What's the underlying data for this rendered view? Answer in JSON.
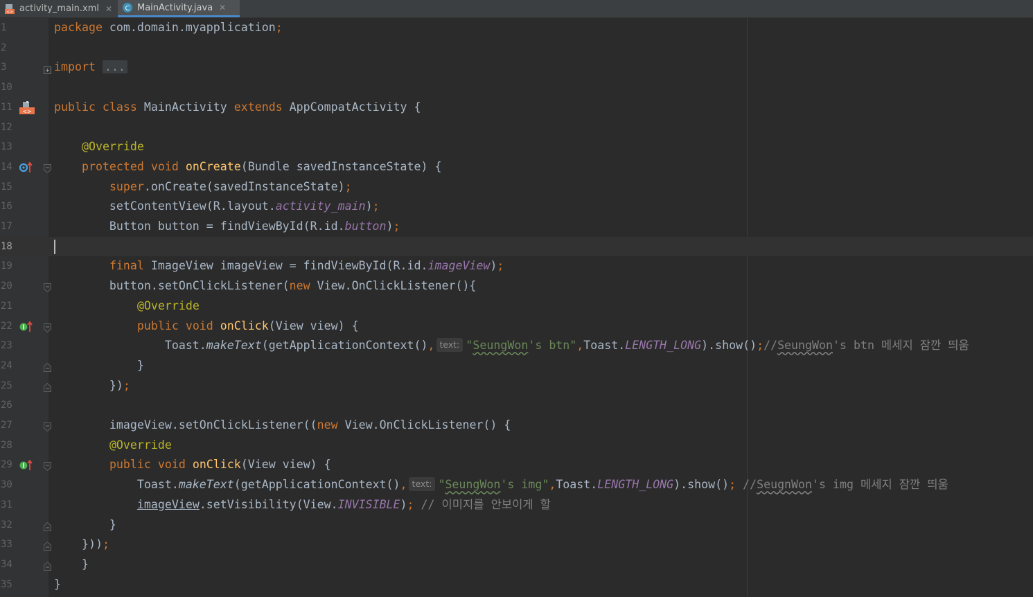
{
  "tabs": [
    {
      "label": "activity_main.xml",
      "active": false
    },
    {
      "label": "MainActivity.java",
      "active": true
    }
  ],
  "colors": {
    "background": "#2b2b2b",
    "keyword": "#cc7832",
    "annotation": "#bbb529",
    "method_declaration": "#ffc66d",
    "string": "#6a8759",
    "static_field": "#9876aa",
    "comment": "#808080",
    "default_text": "#a9b7c6"
  },
  "editor": {
    "current_line": "18",
    "lines": [
      {
        "n": "1",
        "tokens": [
          [
            "kw",
            "package"
          ],
          [
            "t",
            " com.domain.myapplication"
          ],
          [
            "kw",
            ";"
          ]
        ]
      },
      {
        "n": "2",
        "tokens": []
      },
      {
        "n": "3",
        "fold": "plus",
        "tokens": [
          [
            "kw",
            "import"
          ],
          [
            "t",
            " "
          ],
          [
            "fold",
            "..."
          ]
        ]
      },
      {
        "n": "10",
        "tokens": []
      },
      {
        "n": "11",
        "marker": "class-icon",
        "tokens": [
          [
            "kw",
            "public class"
          ],
          [
            "t",
            " MainActivity "
          ],
          [
            "kw",
            "extends"
          ],
          [
            "t",
            " AppCompatActivity {"
          ]
        ]
      },
      {
        "n": "12",
        "tokens": []
      },
      {
        "n": "13",
        "tokens": [
          [
            "t",
            "    "
          ],
          [
            "an",
            "@Override"
          ]
        ]
      },
      {
        "n": "14",
        "marker": "override-up",
        "fold": "open",
        "tokens": [
          [
            "t",
            "    "
          ],
          [
            "kw",
            "protected void"
          ],
          [
            "t",
            " "
          ],
          [
            "fn",
            "onCreate"
          ],
          [
            "t",
            "(Bundle savedInstanceState) {"
          ]
        ]
      },
      {
        "n": "15",
        "tokens": [
          [
            "t",
            "        "
          ],
          [
            "kw",
            "super"
          ],
          [
            "t",
            ".onCreate(savedInstanceState)"
          ],
          [
            "kw",
            ";"
          ]
        ]
      },
      {
        "n": "16",
        "tokens": [
          [
            "t",
            "        setContentView(R.layout."
          ],
          [
            "fd",
            "activity_main"
          ],
          [
            "t",
            ")"
          ],
          [
            "kw",
            ";"
          ]
        ]
      },
      {
        "n": "17",
        "tokens": [
          [
            "t",
            "        Button button = findViewById(R.id."
          ],
          [
            "fd",
            "button"
          ],
          [
            "t",
            ")"
          ],
          [
            "kw",
            ";"
          ]
        ]
      },
      {
        "n": "18",
        "tokens": []
      },
      {
        "n": "19",
        "tokens": [
          [
            "t",
            "        "
          ],
          [
            "kw",
            "final"
          ],
          [
            "t",
            " ImageView imageView = findViewById(R.id."
          ],
          [
            "fd",
            "imageView"
          ],
          [
            "t",
            ")"
          ],
          [
            "kw",
            ";"
          ]
        ]
      },
      {
        "n": "20",
        "fold": "open",
        "tokens": [
          [
            "t",
            "        button.setOnClickListener("
          ],
          [
            "kw",
            "new"
          ],
          [
            "t",
            " View.OnClickListener(){"
          ]
        ]
      },
      {
        "n": "21",
        "tokens": [
          [
            "t",
            "            "
          ],
          [
            "an",
            "@Override"
          ]
        ]
      },
      {
        "n": "22",
        "marker": "implement-up",
        "fold": "open",
        "tokens": [
          [
            "t",
            "            "
          ],
          [
            "kw",
            "public void"
          ],
          [
            "t",
            " "
          ],
          [
            "fn",
            "onClick"
          ],
          [
            "t",
            "(View view) {"
          ]
        ]
      },
      {
        "n": "23",
        "tokens": [
          [
            "t",
            "                Toast."
          ],
          [
            "it",
            "makeText"
          ],
          [
            "t",
            "(getApplicationContext()"
          ],
          [
            "kw",
            ","
          ],
          [
            "hint",
            "text:"
          ],
          [
            "st",
            "\""
          ],
          [
            "stw",
            "SeungWon"
          ],
          [
            "st",
            "'s btn\""
          ],
          [
            "kw",
            ","
          ],
          [
            "t",
            "Toast."
          ],
          [
            "fd",
            "LENGTH_LONG"
          ],
          [
            "t",
            ").show()"
          ],
          [
            "kw",
            ";"
          ],
          [
            "cm",
            "//"
          ],
          [
            "cmw",
            "SeungWon"
          ],
          [
            "cm",
            "'s btn 메세지 잠깐 띄움"
          ]
        ]
      },
      {
        "n": "24",
        "fold": "close",
        "tokens": [
          [
            "t",
            "            }"
          ]
        ]
      },
      {
        "n": "25",
        "fold": "close",
        "tokens": [
          [
            "t",
            "        })"
          ],
          [
            "kw",
            ";"
          ]
        ]
      },
      {
        "n": "26",
        "tokens": []
      },
      {
        "n": "27",
        "fold": "open",
        "tokens": [
          [
            "t",
            "        imageView.setOnClickListener(("
          ],
          [
            "kw",
            "new"
          ],
          [
            "t",
            " View.OnClickListener() {"
          ]
        ]
      },
      {
        "n": "28",
        "tokens": [
          [
            "t",
            "        "
          ],
          [
            "an",
            "@Override"
          ]
        ]
      },
      {
        "n": "29",
        "marker": "implement-up",
        "fold": "open",
        "tokens": [
          [
            "t",
            "        "
          ],
          [
            "kw",
            "public void"
          ],
          [
            "t",
            " "
          ],
          [
            "fn",
            "onClick"
          ],
          [
            "t",
            "(View view) {"
          ]
        ]
      },
      {
        "n": "30",
        "tokens": [
          [
            "t",
            "            Toast."
          ],
          [
            "it",
            "makeText"
          ],
          [
            "t",
            "(getApplicationContext()"
          ],
          [
            "kw",
            ","
          ],
          [
            "hint",
            "text:"
          ],
          [
            "st",
            "\""
          ],
          [
            "stw",
            "SeungWon"
          ],
          [
            "st",
            "'s img\""
          ],
          [
            "kw",
            ","
          ],
          [
            "t",
            "Toast."
          ],
          [
            "fd",
            "LENGTH_LONG"
          ],
          [
            "t",
            ").show()"
          ],
          [
            "kw",
            ";"
          ],
          [
            "t",
            " "
          ],
          [
            "cm",
            "//"
          ],
          [
            "cmw",
            "SeugnWon"
          ],
          [
            "cm",
            "'s img 메세지 잠깐 띄움"
          ]
        ]
      },
      {
        "n": "31",
        "tokens": [
          [
            "t",
            "            "
          ],
          [
            "ul",
            "imageView"
          ],
          [
            "t",
            ".setVisibility(View."
          ],
          [
            "fd",
            "INVISIBLE"
          ],
          [
            "t",
            ")"
          ],
          [
            "kw",
            ";"
          ],
          [
            "t",
            " "
          ],
          [
            "cm",
            "// 이미지를 안보이게 할"
          ]
        ]
      },
      {
        "n": "32",
        "fold": "close",
        "tokens": [
          [
            "t",
            "        }"
          ]
        ]
      },
      {
        "n": "33",
        "fold": "close",
        "tokens": [
          [
            "t",
            "    }))"
          ],
          [
            "kw",
            ";"
          ]
        ]
      },
      {
        "n": "34",
        "fold": "close",
        "tokens": [
          [
            "t",
            "    }"
          ]
        ]
      },
      {
        "n": "35",
        "tokens": [
          [
            "t",
            "}"
          ]
        ]
      }
    ]
  }
}
